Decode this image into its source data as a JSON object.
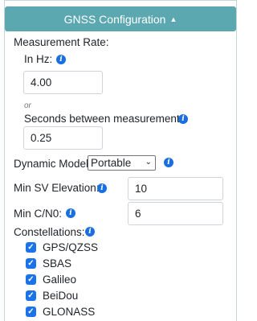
{
  "header": {
    "title": "GNSS Configuration"
  },
  "measurement": {
    "label": "Measurement Rate:",
    "hz_label": "In Hz:",
    "hz_value": "4.00",
    "or_text": "or",
    "seconds_label": "Seconds between measurements:",
    "seconds_value": "0.25"
  },
  "dynamic_model": {
    "label": "Dynamic Model:",
    "selected": "Portable"
  },
  "min_sv_elevation": {
    "label": "Min SV Elevation:",
    "value": "10"
  },
  "min_cn0": {
    "label": "Min C/N0:",
    "value": "6"
  },
  "constellations": {
    "label": "Constellations:",
    "items": [
      {
        "label": "GPS/QZSS",
        "checked": true
      },
      {
        "label": "SBAS",
        "checked": true
      },
      {
        "label": "Galileo",
        "checked": true
      },
      {
        "label": "BeiDou",
        "checked": true
      },
      {
        "label": "GLONASS",
        "checked": true
      }
    ]
  },
  "icons": {
    "info": "info-icon",
    "caret": "caret-up-icon",
    "check": "check-icon"
  },
  "colors": {
    "header": "#5ba8b0",
    "info": "#1a6fe0",
    "checkbox": "#1a73e8"
  }
}
